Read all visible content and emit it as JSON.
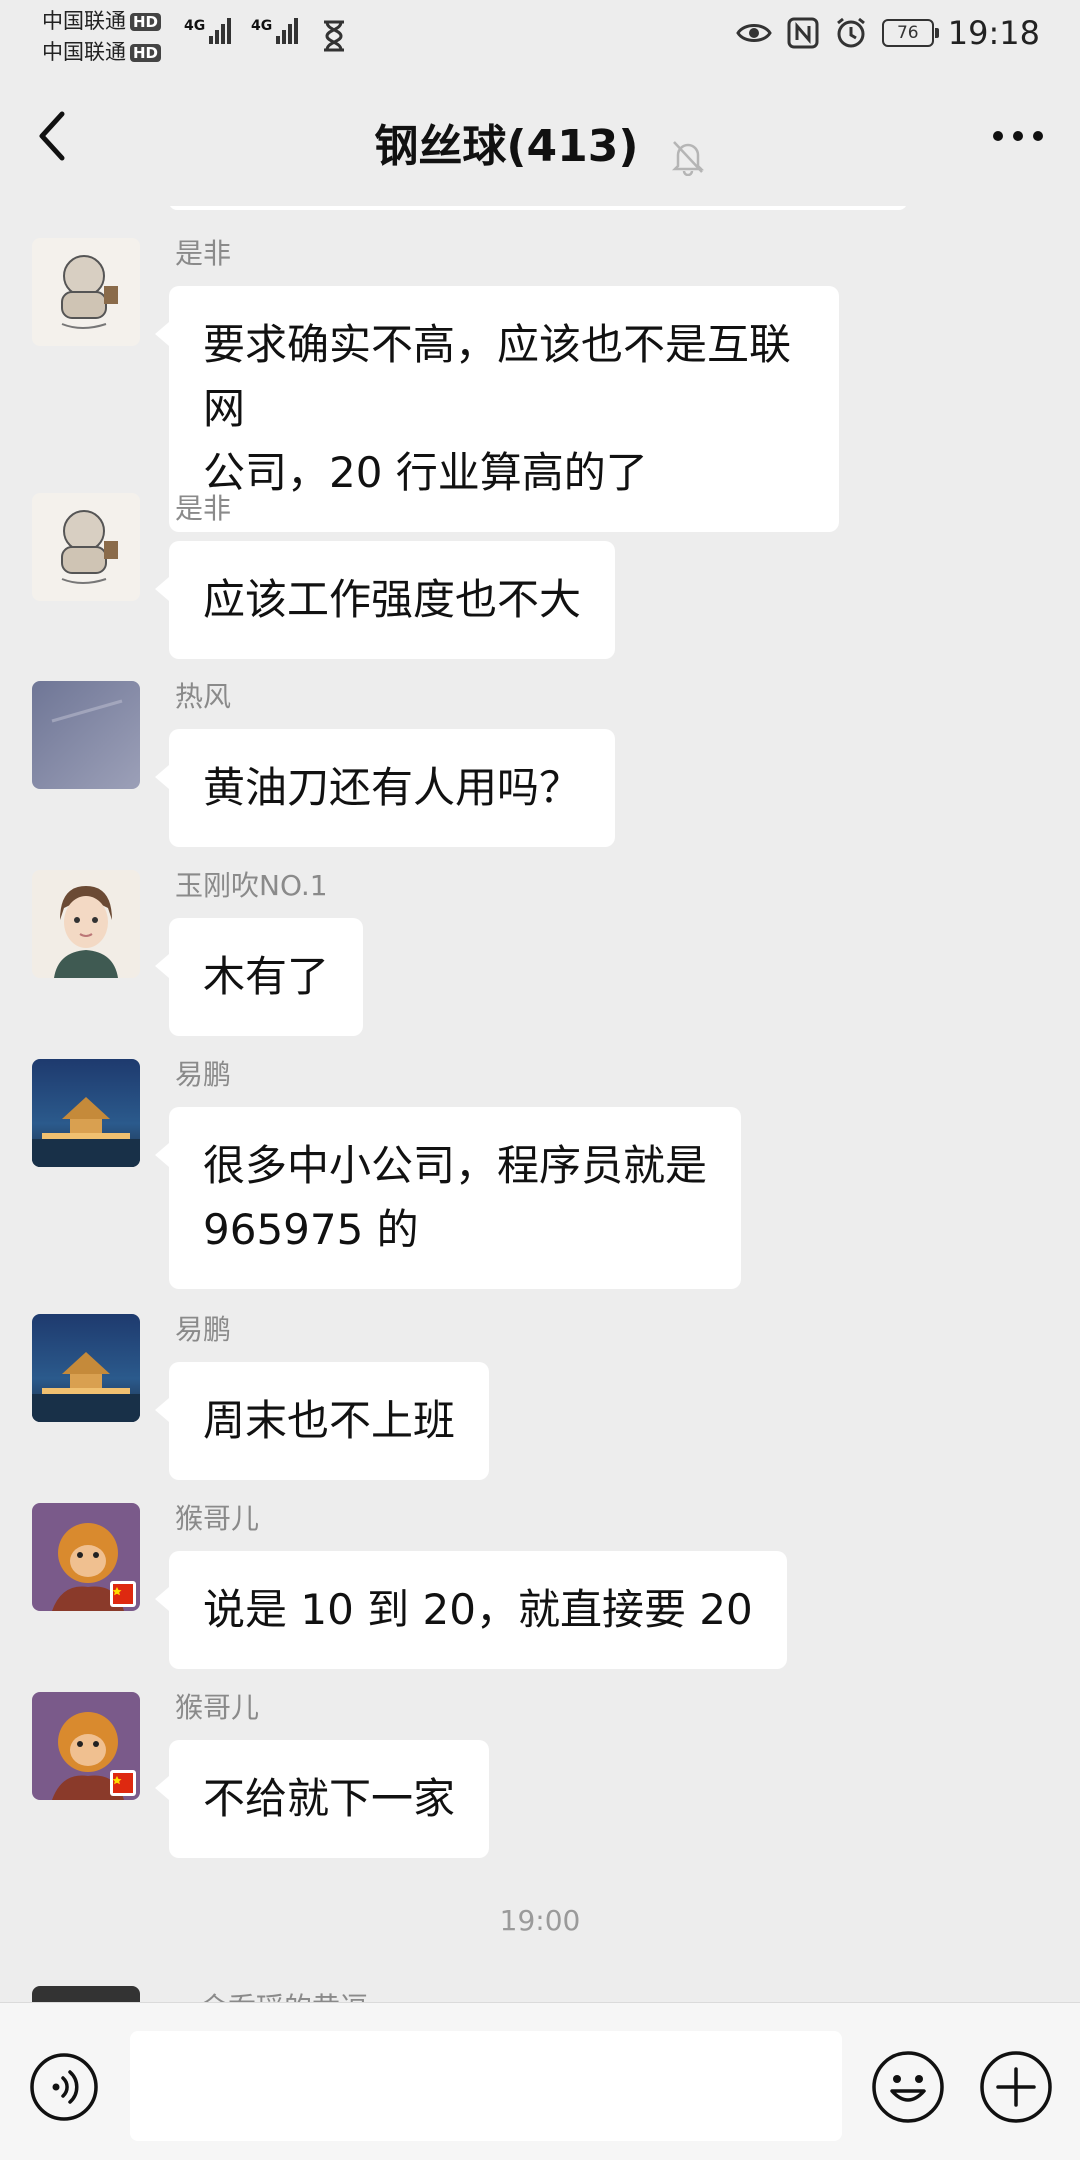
{
  "status_bar": {
    "carrier1": "中国联通",
    "carrier2": "中国联通",
    "hd_badge": "HD",
    "network1": "4G",
    "network2": "4G",
    "battery": "76",
    "time": "19:18"
  },
  "header": {
    "title": "钢丝球(413)"
  },
  "messages": [
    {
      "sender": "是非",
      "text": "要求确实不高，应该也不是互联网\n公司，20 行业算高的了"
    },
    {
      "sender": "是非",
      "text": "应该工作强度也不大"
    },
    {
      "sender": "热风",
      "text": "黄油刀还有人用吗？"
    },
    {
      "sender": "玉刚吹NO.1",
      "text": "木有了"
    },
    {
      "sender": "易鹏",
      "text": "很多中小公司，程序员就是\n965975 的"
    },
    {
      "sender": "易鹏",
      "text": "周末也不上班"
    },
    {
      "sender": "猴哥儿",
      "text": "说是 10 到 20，就直接要 20"
    },
    {
      "sender": "猴哥儿",
      "text": "不给就下一家"
    }
  ],
  "time_divider": "19:00",
  "partial_sender": "会乔瑶的黄逗",
  "input": {
    "placeholder": ""
  }
}
